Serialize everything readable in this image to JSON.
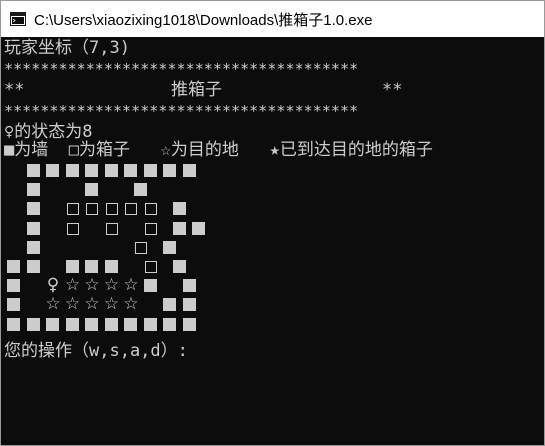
{
  "window": {
    "title": "C:\\Users\\xiaozixing1018\\Downloads\\推箱子1.0.exe",
    "icon": "console-app-icon"
  },
  "console": {
    "coords_line": "玩家坐标（7,3)",
    "stars_line_1": "***************************************",
    "banner_left": "**",
    "banner_title": "推箱子",
    "banner_right": "**",
    "stars_line_2": "***************************************",
    "state_line": "♀的状态为8",
    "legend_line": "■为墙  □为箱子   ☆为目的地   ★已到达目的地的箱子",
    "prompt_line": "您的操作（w,s,a,d）:"
  },
  "map": {
    "rows": [
      "  ■■■■■■■■■",
      "  ■    ■   ■",
      "  ■  □□□□□ ■",
      "  ■  □  □  □ ■■",
      "  ■         □ ■",
      "■■  ■■■  □ ■",
      "■  ♀☆☆☆☆■  ■",
      "■  ☆☆☆☆☆  ■■",
      "■■■■■■■■■■"
    ]
  }
}
